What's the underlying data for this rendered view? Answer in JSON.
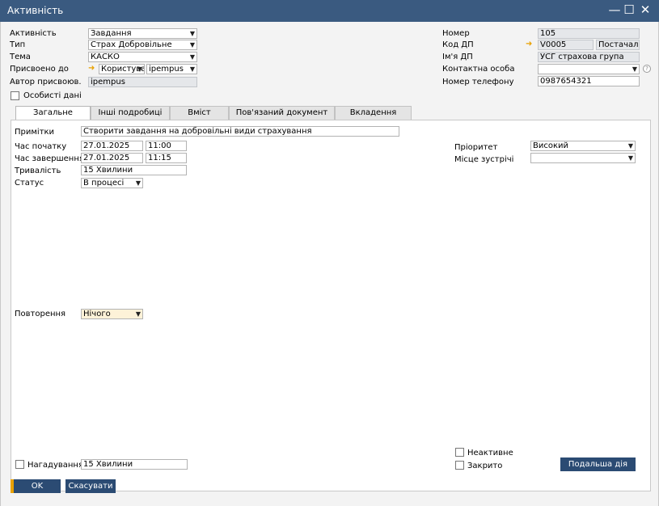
{
  "window": {
    "title": "Активність"
  },
  "header_left": {
    "activity_label": "Активність",
    "activity_value": "Завдання",
    "type_label": "Тип",
    "type_value": "Страх Добровільне",
    "subject_label": "Тема",
    "subject_value": "КАСКО",
    "assigned_label": "Присвоено до",
    "assigned_type": "Користувач",
    "assigned_user": "ipempus",
    "author_label": "Автор присвоюв.",
    "author_value": "ipempus",
    "personal_label": "Особисті дані"
  },
  "header_right": {
    "number_label": "Номер",
    "number_value": "105",
    "bp_code_label": "Код ДП",
    "bp_code_value": "V0005",
    "bp_type_value": "Постачальн",
    "bp_name_label": "Ім'я ДП",
    "bp_name_value": "УСГ страхова група",
    "contact_label": "Контактна особа",
    "contact_value": "",
    "phone_label": "Номер телефону",
    "phone_value": "0987654321"
  },
  "tabs": [
    "Загальне",
    "Інші подробиці",
    "Вміст",
    "Пов'язаний документ",
    "Вкладення"
  ],
  "general": {
    "remarks_label": "Примітки",
    "remarks_value": "Створити завдання на добровільні види страхування",
    "start_label": "Час початку",
    "start_date": "27.01.2025",
    "start_time": "11:00",
    "end_label": "Час завершення",
    "end_date": "27.01.2025",
    "end_time": "11:15",
    "duration_label": "Тривалість",
    "duration_value": "15 Хвилини",
    "status_label": "Статус",
    "status_value": "В процесі",
    "priority_label": "Пріоритет",
    "priority_value": "Високий",
    "meeting_label": "Місце зустрічі",
    "meeting_value": "",
    "recurrence_label": "Повторення",
    "recurrence_value": "Нічого",
    "reminder_label": "Нагадування",
    "reminder_value": "15 Хвилини",
    "inactive_label": "Неактивне",
    "closed_label": "Закрито"
  },
  "buttons": {
    "next_action": "Подальша дія",
    "ok": "OK",
    "cancel": "Скасувати"
  }
}
